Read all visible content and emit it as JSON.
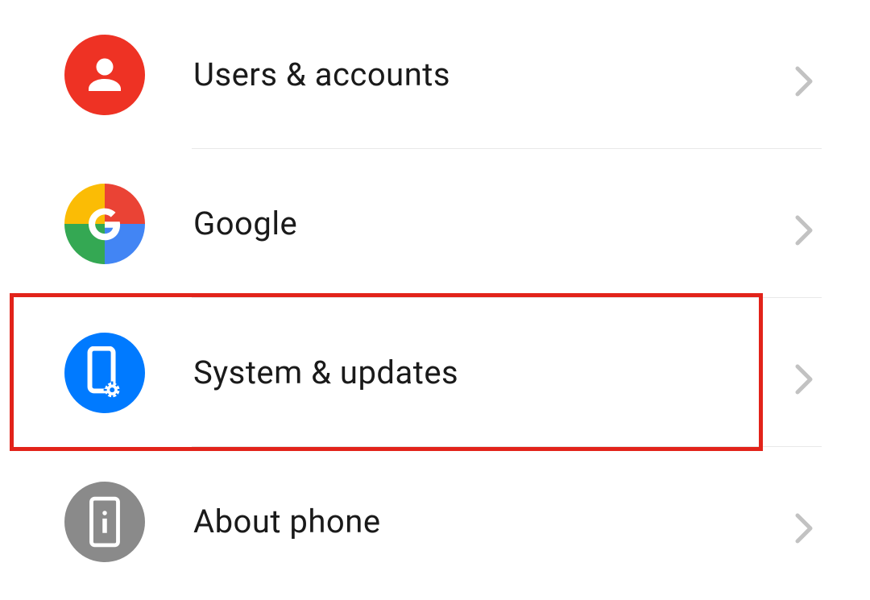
{
  "settings": {
    "items": [
      {
        "label": "Users & accounts",
        "icon": "person-icon",
        "highlighted": false
      },
      {
        "label": "Google",
        "icon": "google-icon",
        "highlighted": false
      },
      {
        "label": "System & updates",
        "icon": "phone-gear-icon",
        "highlighted": true
      },
      {
        "label": "About phone",
        "icon": "phone-info-icon",
        "highlighted": false
      }
    ]
  },
  "colors": {
    "highlight": "#e2231a",
    "icon_red": "#ee3224",
    "icon_blue": "#007aff",
    "icon_gray": "#8a8a8a"
  }
}
